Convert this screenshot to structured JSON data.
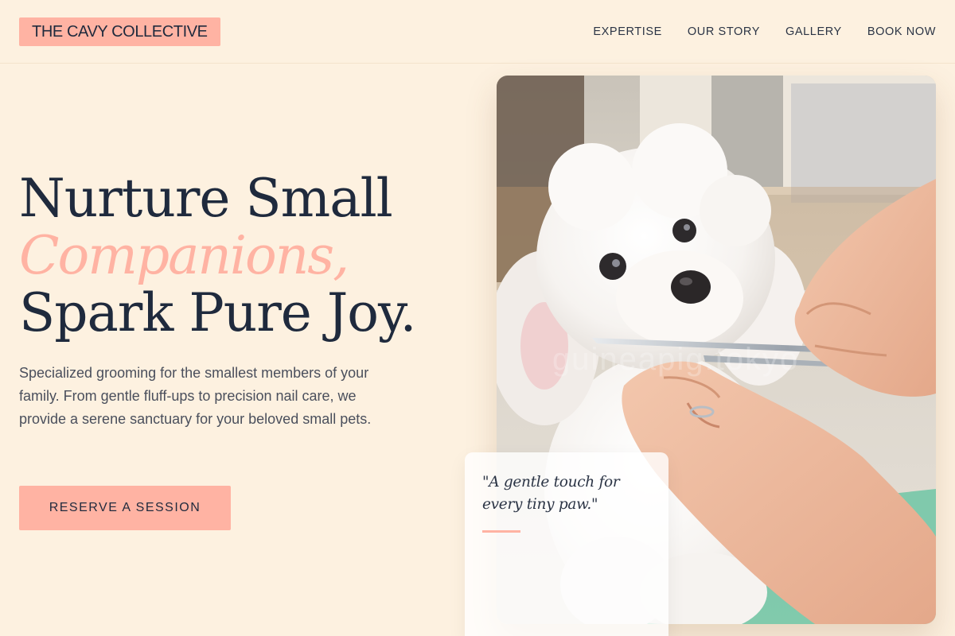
{
  "header": {
    "logo": "THE CAVY COLLECTIVE",
    "nav": [
      "EXPERTISE",
      "OUR STORY",
      "GALLERY",
      "BOOK NOW"
    ]
  },
  "hero": {
    "headline_line1": "Nurture Small",
    "headline_line2": "Companions,",
    "headline_line3": "Spark Pure Joy.",
    "description": "Specialized grooming for the smallest members of your family. From gentle fluff-ups to precision nail care, we provide a serene sanctuary for your beloved small pets.",
    "cta_label": "RESERVE A SESSION"
  },
  "image": {
    "alt": "A groomer trimming a small white fluffy dog with scissors",
    "watermark": "guineapig.tokyo"
  },
  "quote": {
    "text": "\"A gentle touch for every tiny paw.\""
  },
  "colors": {
    "background": "#fdf1e0",
    "accent": "#ffb3a3",
    "ink": "#1f2a3d"
  }
}
